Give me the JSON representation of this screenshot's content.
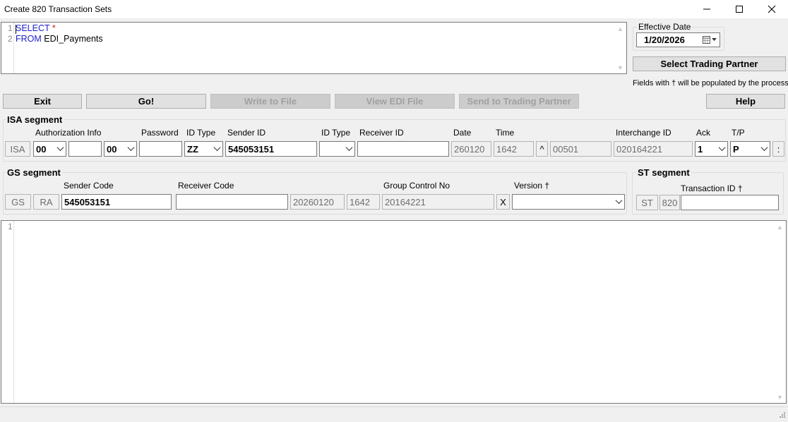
{
  "window": {
    "title": "Create 820 Transaction Sets"
  },
  "query_editor": {
    "lines": [
      {
        "num": "1",
        "keyword": "SELECT",
        "rest": " *"
      },
      {
        "num": "2",
        "keyword": "FROM",
        "rest": " EDI_Payments"
      }
    ]
  },
  "effective_date": {
    "label": "Effective Date",
    "value": "1/20/2026"
  },
  "select_partner_label": "Select Trading Partner",
  "note": "Fields with † will be populated by the process.",
  "toolbar": {
    "exit": "Exit",
    "go": "Go!",
    "write": "Write to File",
    "view": "View EDI File",
    "send": "Send to Trading Partner",
    "help": "Help"
  },
  "isa": {
    "title": "ISA segment",
    "labels": {
      "auth": "Authorization Info",
      "password": "Password",
      "id_type": "ID Type",
      "sender_id": "Sender ID",
      "id_type2": "ID Type",
      "receiver_id": "Receiver ID",
      "date": "Date",
      "time": "Time",
      "interchange": "Interchange ID",
      "ack": "Ack",
      "tp": "T/P"
    },
    "values": {
      "seg": "ISA",
      "auth_qual": "00",
      "auth_info": "",
      "sec_qual": "00",
      "password": "",
      "id_type": "ZZ",
      "sender_id": "545053151",
      "id_type2": "",
      "receiver_id": "",
      "date": "260120",
      "time": "1642",
      "rep_sep": "^",
      "version": "00501",
      "interchange": "020164221",
      "ack": "1",
      "tp": "P",
      "sub_sep": ":"
    }
  },
  "gs": {
    "title": "GS segment",
    "labels": {
      "sender_code": "Sender Code",
      "receiver_code": "Receiver Code",
      "group_control": "Group Control No",
      "version": "Version †"
    },
    "values": {
      "seg": "GS",
      "func": "RA",
      "sender_code": "545053151",
      "receiver_code": "",
      "date": "20260120",
      "time": "1642",
      "group_control": "20164221",
      "agency": "X",
      "version": ""
    }
  },
  "st": {
    "title": "ST segment",
    "labels": {
      "transaction_id": "Transaction ID †"
    },
    "values": {
      "seg": "ST",
      "code": "820",
      "transaction_id": ""
    }
  },
  "output_editor": {
    "lines": [
      {
        "num": "1"
      }
    ]
  }
}
